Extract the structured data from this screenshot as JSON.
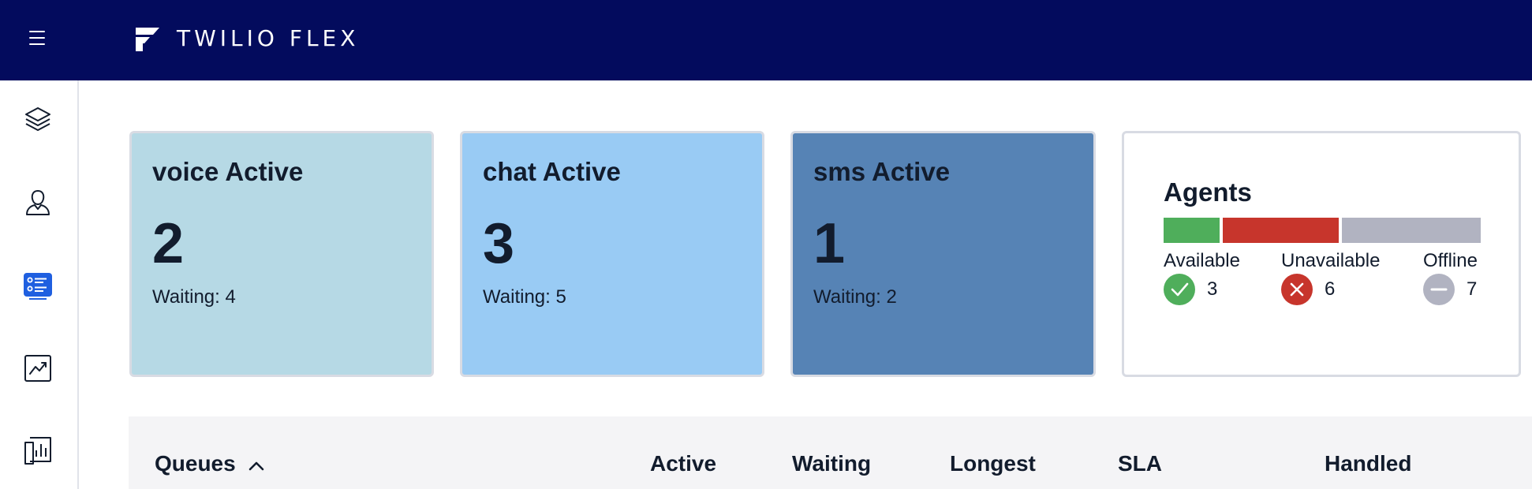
{
  "header": {
    "brand": "TWILIO FLEX",
    "menu_icon": "hamburger-menu-icon",
    "logo_icon": "twilio-flex-logo-icon",
    "background": "#030b5d"
  },
  "sidebar": {
    "items": [
      {
        "icon": "layers-icon",
        "active": false
      },
      {
        "icon": "agents-icon",
        "active": false
      },
      {
        "icon": "queues-stats-icon",
        "active": true
      },
      {
        "icon": "analytics-chart-icon",
        "active": false
      },
      {
        "icon": "reports-icon",
        "active": false
      }
    ],
    "active_color": "#1f5fe0"
  },
  "channels": [
    {
      "title": "voice Active",
      "active": "2",
      "waiting_label": "Waiting:",
      "waiting": "4",
      "color": "#b6d9e5"
    },
    {
      "title": "chat Active",
      "active": "3",
      "waiting_label": "Waiting:",
      "waiting": "5",
      "color": "#99cbf4"
    },
    {
      "title": "sms Active",
      "active": "1",
      "waiting_label": "Waiting:",
      "waiting": "2",
      "color": "#5683b5"
    }
  ],
  "agents": {
    "title": "Agents",
    "statuses": [
      {
        "label": "Available",
        "count": "3",
        "color": "#4fae5b",
        "icon": "check-icon"
      },
      {
        "label": "Unavailable",
        "count": "6",
        "color": "#c7352c",
        "icon": "x-icon"
      },
      {
        "label": "Offline",
        "count": "7",
        "color": "#b1b3c1",
        "icon": "minus-icon"
      }
    ]
  },
  "table": {
    "columns": [
      "Queues",
      "Active",
      "Waiting",
      "Longest",
      "SLA",
      "Handled"
    ],
    "sort_icon": "chevron-up-icon"
  }
}
